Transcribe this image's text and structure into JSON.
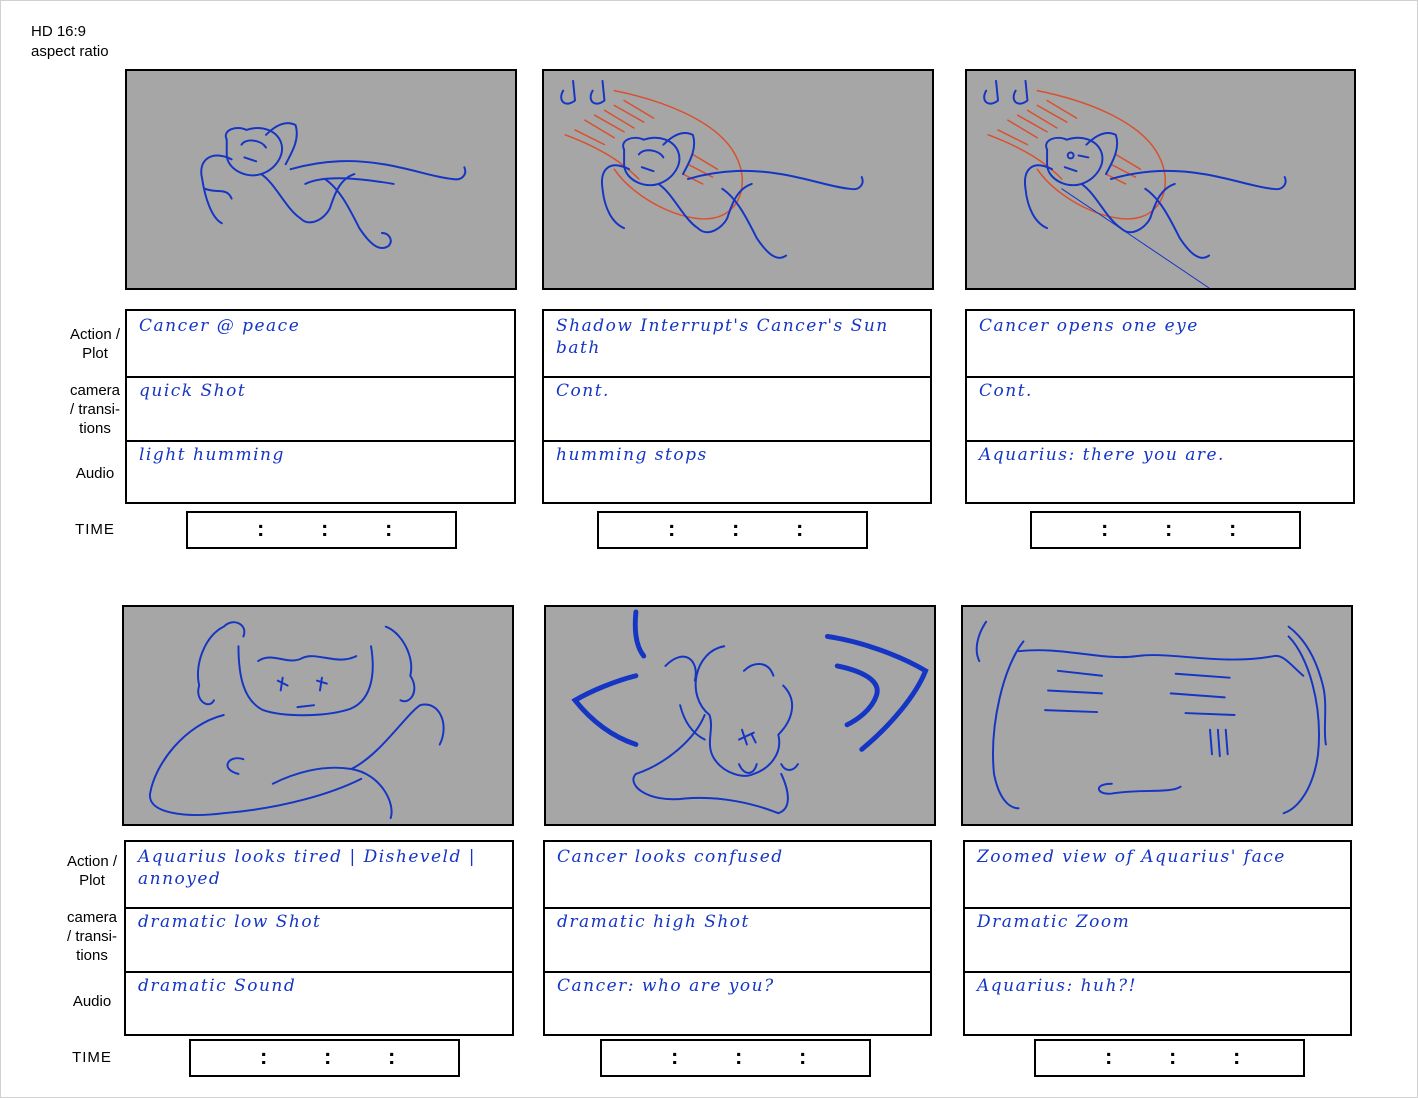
{
  "header": {
    "line1": "HD 16:9",
    "line2": "aspect ratio"
  },
  "labels": {
    "action_line1": "Action /",
    "action_line2": "Plot",
    "camera_line1": "camera",
    "camera_line2": "/ transi-",
    "camera_line3": "tions",
    "audio": "Audio",
    "time": "TIME"
  },
  "time_colon": ":",
  "panels": [
    {
      "action": "Cancer @ peace",
      "camera": "quick Shot",
      "audio": "light humming",
      "sketch": "figure-lying"
    },
    {
      "action": "Shadow Interrupt's Cancer's Sun bath",
      "camera": "Cont.",
      "audio": "humming stops",
      "sketch": "figure-lying-shadow"
    },
    {
      "action": "Cancer opens one eye",
      "camera": "Cont.",
      "audio": "Aquarius: there you are.",
      "sketch": "figure-lying-shadow-eye"
    },
    {
      "action": "Aquarius looks tired | Disheveld | annoyed",
      "camera": "dramatic low Shot",
      "audio": "dramatic Sound",
      "sketch": "aquarius-arms-crossed"
    },
    {
      "action": "Cancer looks confused",
      "camera": "dramatic high Shot",
      "audio": "Cancer: who are you?",
      "sketch": "cancer-upside-down"
    },
    {
      "action": "Zoomed view of Aquarius' face",
      "camera": "Dramatic Zoom",
      "audio": "Aquarius: huh?!",
      "sketch": "aquarius-face-zoom"
    }
  ],
  "colors": {
    "frame_fill": "#a6a6a6",
    "sketch_ink": "#1535c4",
    "shadow_ink": "#d9502e"
  }
}
